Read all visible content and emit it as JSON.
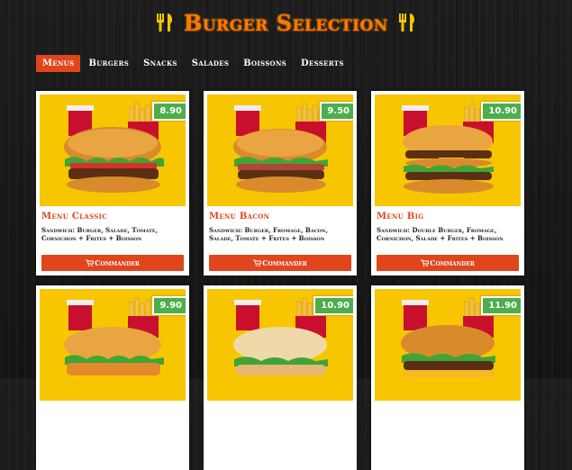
{
  "header": {
    "title": "Burger Selection",
    "icon": "fork-knife-icon",
    "title_color": "#ff7a00"
  },
  "nav": {
    "tabs": [
      {
        "label": "Menus",
        "active": true
      },
      {
        "label": "Burgers",
        "active": false
      },
      {
        "label": "Snacks",
        "active": false
      },
      {
        "label": "Salades",
        "active": false
      },
      {
        "label": "Boissons",
        "active": false
      },
      {
        "label": "Desserts",
        "active": false
      }
    ],
    "active_color": "#e0451b"
  },
  "cards": [
    {
      "price": "8.90",
      "name": "Menu Classic",
      "desc": "Sandwich: Burger, Salade, Tomate, Cornichon + Frites + Boisson",
      "button": "Commander"
    },
    {
      "price": "9.50",
      "name": "Menu Bacon",
      "desc": "Sandwich: Burger, Fromage, Bacon, Salade, Tomate + Frites + Boisson",
      "button": "Commander"
    },
    {
      "price": "10.90",
      "name": "Menu Big",
      "desc": "Sandwich: Double Burger, Fromage, Cornichon, Salade + Frites + Boisson",
      "button": "Commander"
    },
    {
      "price": "9.90"
    },
    {
      "price": "10.90"
    },
    {
      "price": "11.90"
    }
  ],
  "colors": {
    "card_image_bg": "#f7c600",
    "price_badge": "#4cae4c",
    "button": "#e0451b"
  }
}
